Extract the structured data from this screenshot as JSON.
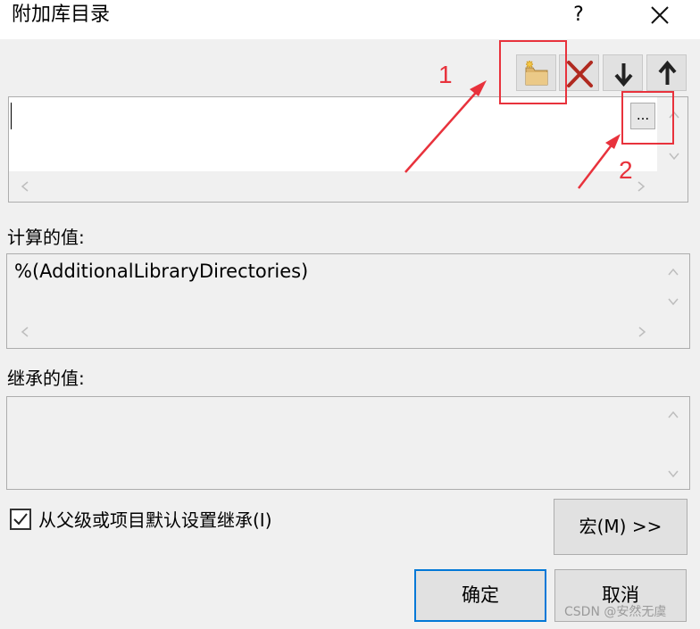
{
  "window": {
    "title": "附加库目录",
    "help_label": "?",
    "close_icon": "close-icon"
  },
  "toolbar": {
    "new_line_icon": "new-folder-icon",
    "delete_icon": "delete-x-icon",
    "move_down_icon": "arrow-down-icon",
    "move_up_icon": "arrow-up-icon"
  },
  "editor": {
    "current_value": "",
    "browse_label": "..."
  },
  "computed": {
    "label": "计算的值:",
    "value": "%(AdditionalLibraryDirectories)"
  },
  "inherited": {
    "label": "继承的值:",
    "value": ""
  },
  "inherit_checkbox": {
    "label": "从父级或项目默认设置继承(I)",
    "checked": true
  },
  "buttons": {
    "macros": "宏(M) >>",
    "ok": "确定",
    "cancel": "取消"
  },
  "annotations": {
    "marker_1": "1",
    "marker_2": "2",
    "color": "#e8323c"
  },
  "watermark": "CSDN @安然无虞"
}
